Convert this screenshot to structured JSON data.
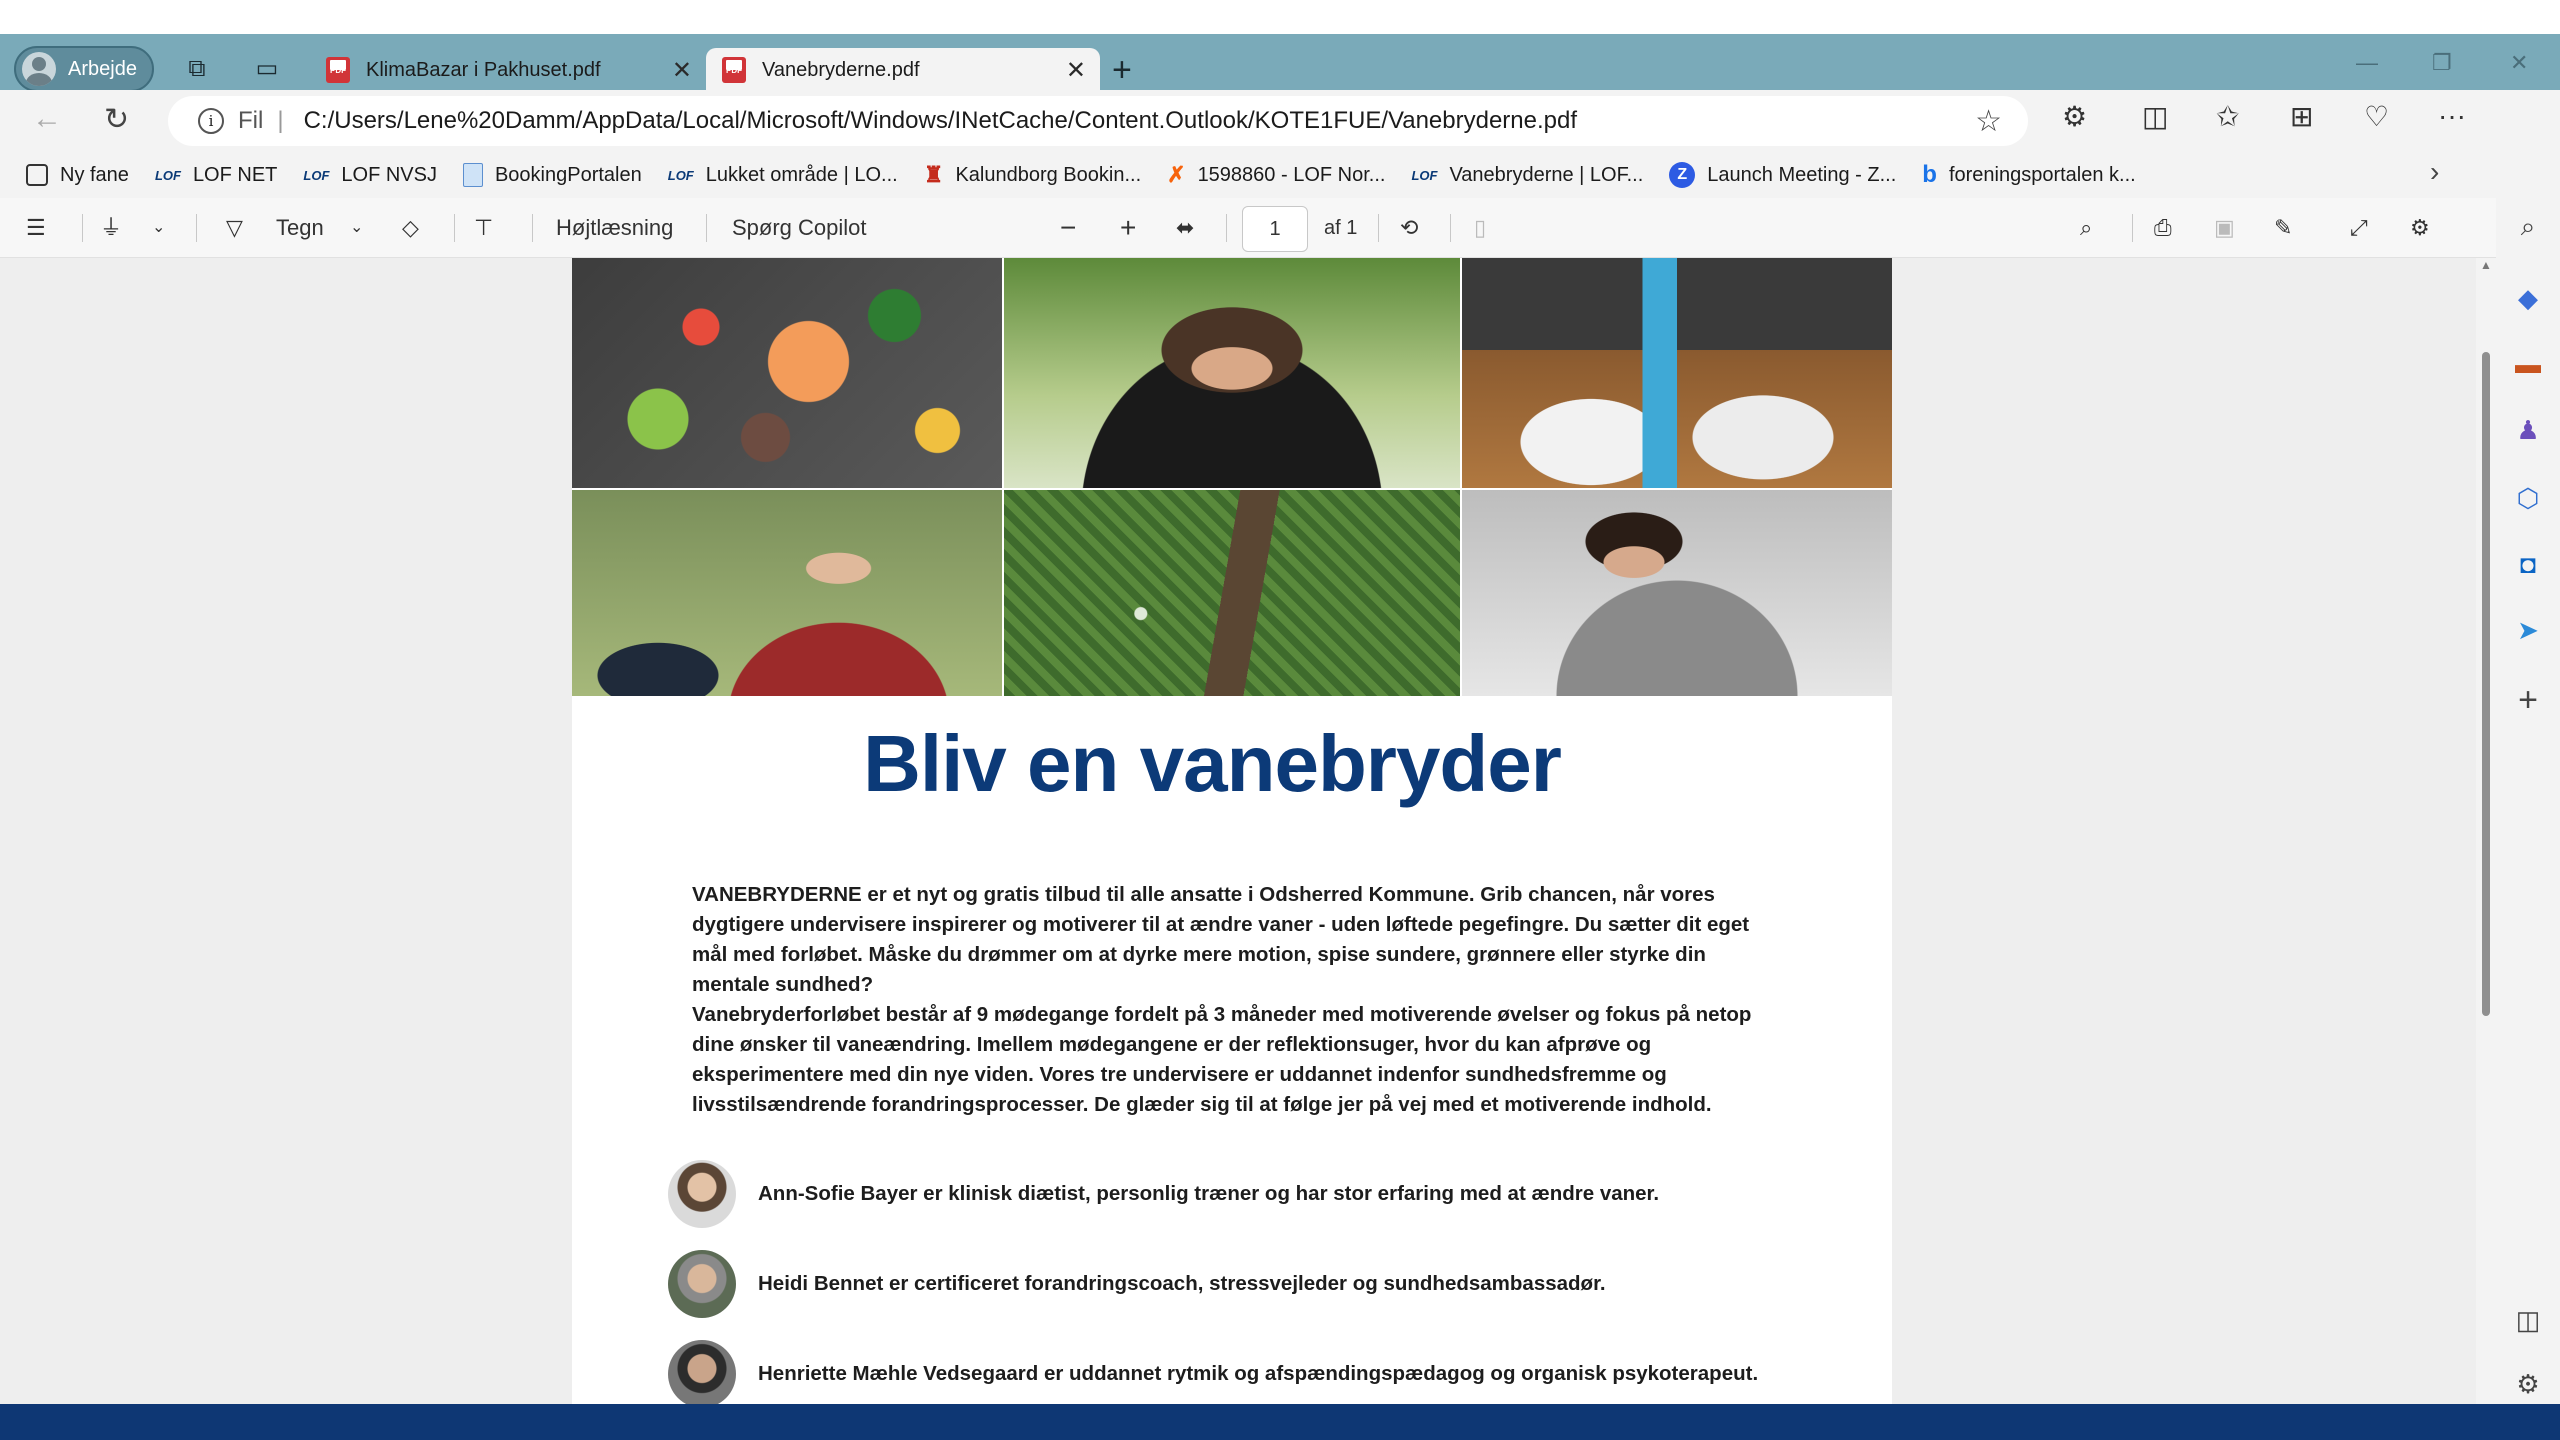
{
  "browser": {
    "profile_label": "Arbejde",
    "tabs": [
      {
        "title": "KlimaBazar i Pakhuset.pdf",
        "active": false
      },
      {
        "title": "Vanebryderne.pdf",
        "active": true
      }
    ],
    "address": {
      "scheme_label": "Fil",
      "url": "C:/Users/Lene%20Damm/AppData/Local/Microsoft/Windows/INetCache/Content.Outlook/KOTE1FUE/Vanebryderne.pdf"
    },
    "bookmarks": [
      {
        "label": "Ny fane",
        "icon": "new-tab-icon"
      },
      {
        "label": "LOF NET",
        "icon": "lof-icon"
      },
      {
        "label": "LOF NVSJ",
        "icon": "lof-icon"
      },
      {
        "label": "BookingPortalen",
        "icon": "document-icon"
      },
      {
        "label": "Lukket område | LO...",
        "icon": "lof-icon"
      },
      {
        "label": "Kalundborg Bookin...",
        "icon": "kalundborg-icon"
      },
      {
        "label": "1598860 - LOF Nor...",
        "icon": "fox-icon"
      },
      {
        "label": "Vanebryderne | LOF...",
        "icon": "lof-icon"
      },
      {
        "label": "Launch Meeting - Z...",
        "icon": "zoom-icon"
      },
      {
        "label": "foreningsportalen k...",
        "icon": "bing-icon"
      }
    ]
  },
  "pdf_toolbar": {
    "draw_label": "Tegn",
    "read_aloud_label": "Højtlæsning",
    "copilot_label": "Spørg Copilot",
    "page_number": "1",
    "page_total": "af 1"
  },
  "document": {
    "title": "Bliv en vanebryder",
    "paragraphs": [
      "VANEBRYDERNE er et nyt og gratis tilbud til alle ansatte i Odsherred Kommune. Grib chancen, når vores dygtigere undervisere inspirerer og motiverer til at ændre vaner - uden løftede pegefingre. Du sætter dit eget mål med forløbet. Måske du drømmer om at dyrke mere motion, spise sundere, grønnere eller styrke din mentale sundhed?",
      "Vanebryderforløbet består af 9 mødegange fordelt på 3 måneder med motiverende øvelser og fokus på netop dine ønsker til vaneændring. Imellem mødegangene er der reflektionsuger, hvor du kan afprøve og eksperimentere med din nye viden. Vores tre undervisere er uddannet indenfor sundhedsfremme og livsstilsændrende forandringsprocesser. De glæder sig til at følge jer på vej med et motiverende indhold."
    ],
    "instructors": [
      "Ann-Sofie Bayer er klinisk diætist, personlig træner og har stor erfaring med at ændre vaner.",
      "Heidi Bennet er certificeret forandringscoach, stressvejleder og sundhedsambassadør.",
      "Henriette Mæhle Vedsegaard er uddannet rytmik og afspændingspædagog og organisk psykoterapeut."
    ]
  },
  "colors": {
    "tabbar": "#7aaab9",
    "title_blue": "#0c3a78",
    "taskbar": "#0e3774"
  }
}
